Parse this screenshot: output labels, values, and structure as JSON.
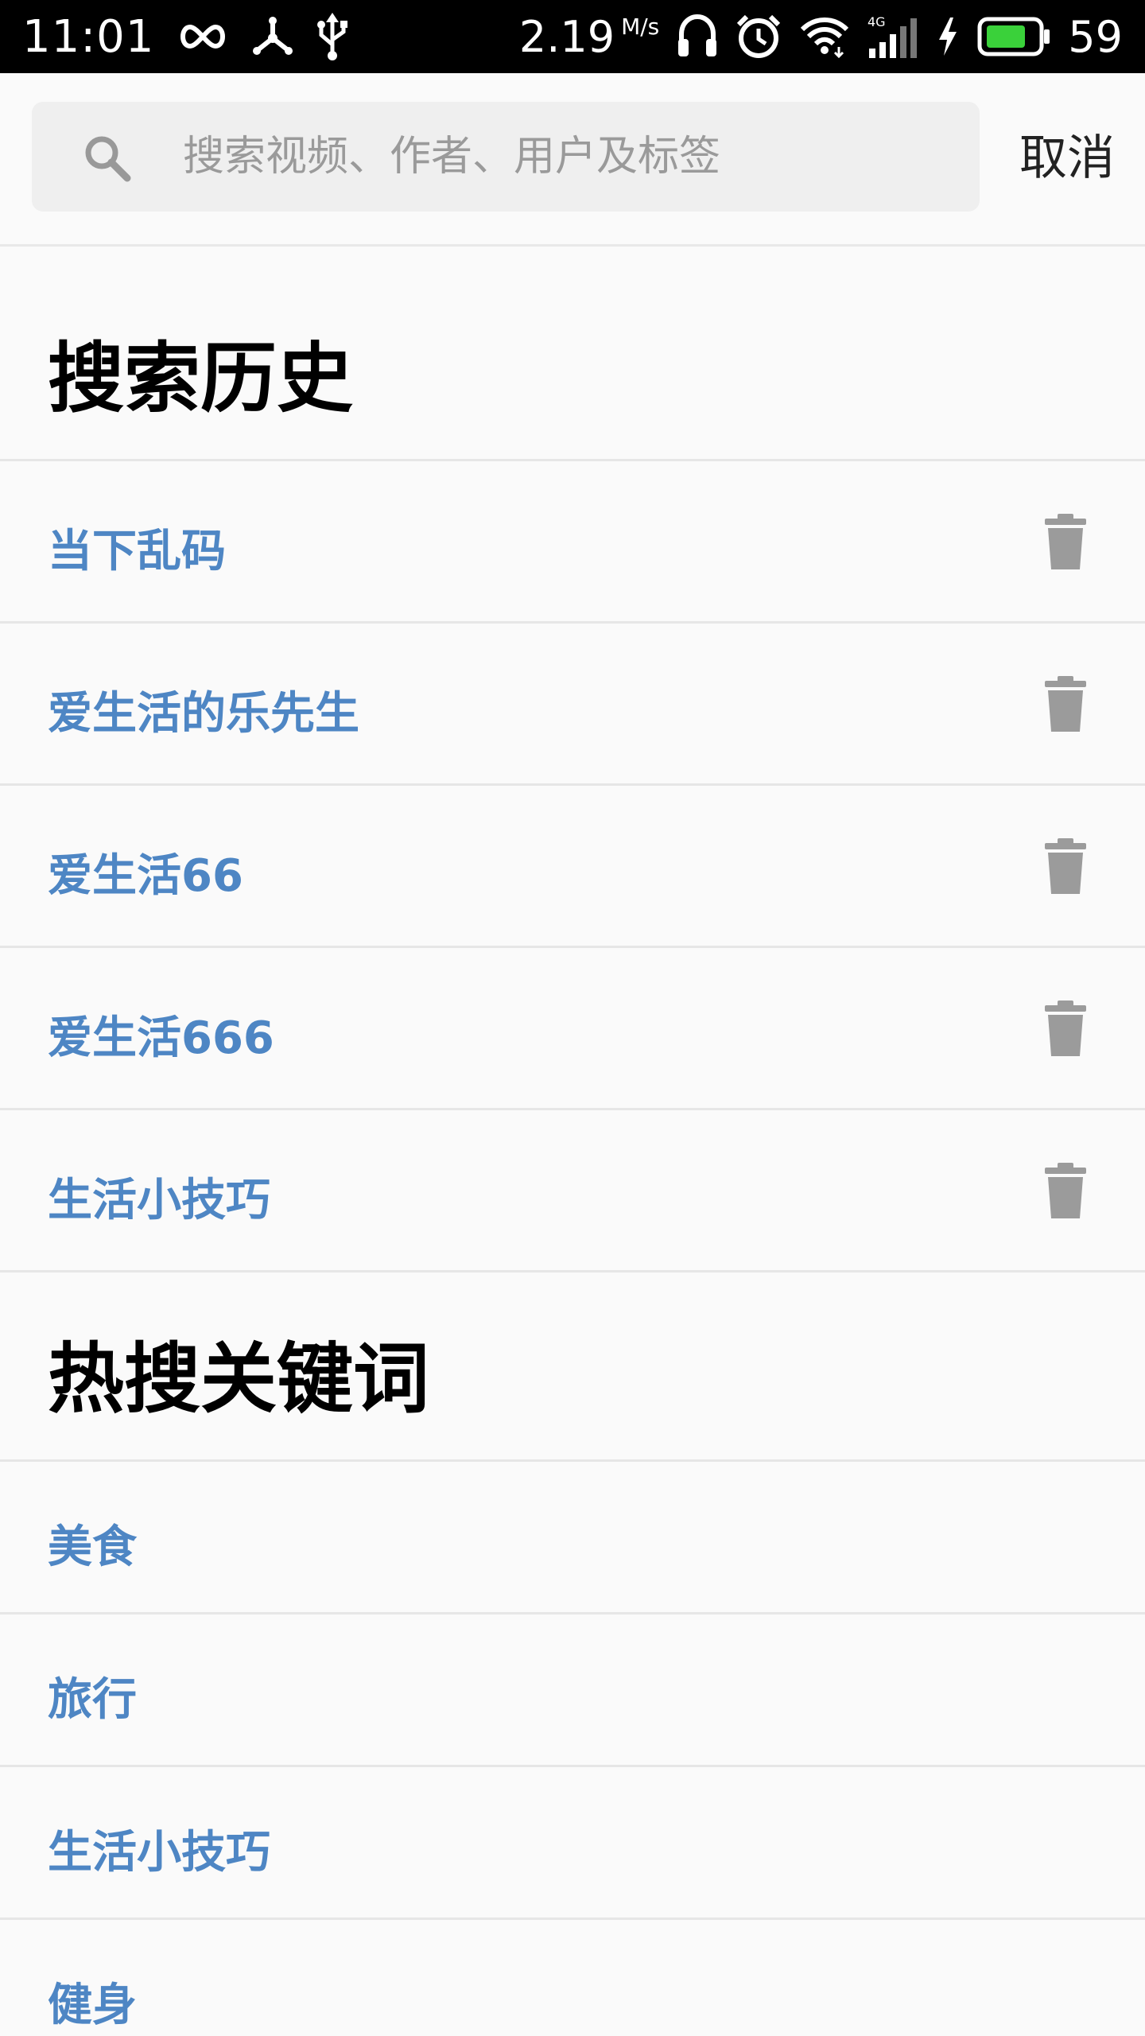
{
  "status_bar": {
    "time": "11:01",
    "speed_value": "2.19",
    "speed_unit": "M/s",
    "battery_level": "59",
    "icons": [
      "infinity-icon",
      "connection-icon",
      "usb-icon",
      "headphones-icon",
      "alarm-icon",
      "wifi-icon",
      "signal-4g-icon",
      "charging-icon",
      "battery-icon"
    ]
  },
  "search": {
    "placeholder": "搜索视频、作者、用户及标签",
    "value": "",
    "cancel_label": "取消"
  },
  "history": {
    "title": "搜索历史",
    "items": [
      {
        "label": "当下乱码"
      },
      {
        "label": "爱生活的乐先生"
      },
      {
        "label": "爱生活66"
      },
      {
        "label": "爱生活666"
      },
      {
        "label": "生活小技巧"
      }
    ]
  },
  "hot": {
    "title": "热搜关键词",
    "items": [
      {
        "label": "美食"
      },
      {
        "label": "旅行"
      },
      {
        "label": "生活小技巧"
      },
      {
        "label": "健身"
      }
    ]
  },
  "colors": {
    "accent": "#4e86c4",
    "trash": "#9b9b9b",
    "status_bar": "#000000",
    "battery_fill": "#3ad13a"
  }
}
